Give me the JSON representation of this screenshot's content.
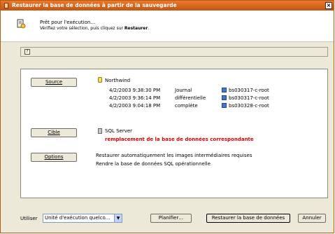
{
  "window": {
    "title": "Restaurer la base de données à partir de la sauvegarde",
    "close": "×"
  },
  "header": {
    "line1": "Prêt pour l'exécution…",
    "line2_prefix": "Vérifiez votre sélection, puis cliquez sur ",
    "line2_bold": "Restaurer",
    "line2_suffix": "."
  },
  "infobar": {
    "icon": "?"
  },
  "source": {
    "button_label": "Source",
    "database": "Northwind",
    "rows": [
      {
        "date": "4/2/2003 9:38:30 PM",
        "type": "Journal",
        "file": "bs030317-c-root"
      },
      {
        "date": "4/2/2003 9:36:14 PM",
        "type": "différentielle",
        "file": "bs030317-c-root"
      },
      {
        "date": "4/2/2003 9:04:18 PM",
        "type": "complète",
        "file": "bs030328-c-root"
      }
    ]
  },
  "target": {
    "button_label": "Cible",
    "server": "SQL Server",
    "warning": "remplacement de la base de données correspondante"
  },
  "options": {
    "button_label": "Options",
    "line1": "Restaurer automatiquement les images intermédiaires requises",
    "line2": "Rendre la base de données SQL opérationnelle"
  },
  "footer": {
    "use_label": "Utiliser",
    "select_value": "Unité d'exécution quelco...",
    "schedule_label": "Planifier…",
    "restore_label": "Restaurer la base de données",
    "cancel_label": "Annuler"
  },
  "icons": {
    "header": "restore-wizard-icon",
    "database": "database-icon",
    "backup_file": "backup-file-icon",
    "server": "server-icon"
  }
}
